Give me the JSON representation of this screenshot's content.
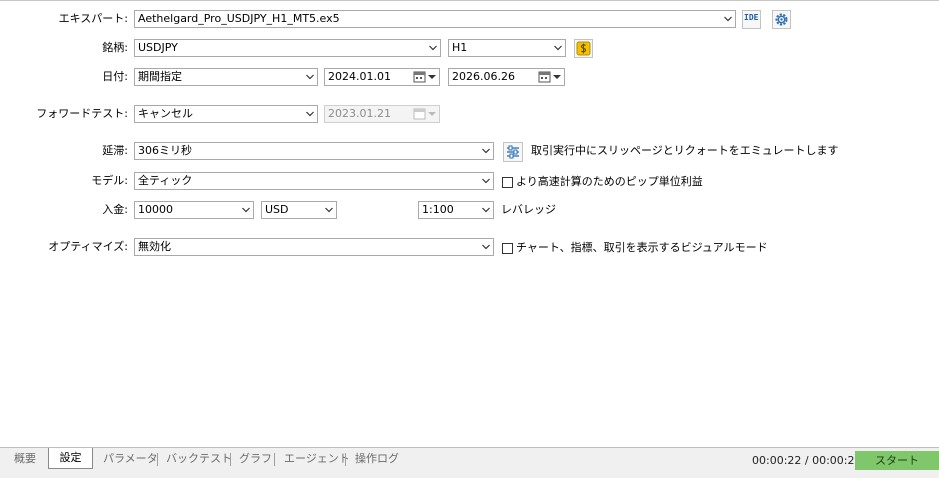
{
  "form": {
    "expert_label": "エキスパート:",
    "expert_value": "Aethelgard_Pro_USDJPY_H1_MT5.ex5",
    "ide_label": "IDE",
    "symbol_label": "銘柄:",
    "symbol_value": "USDJPY",
    "timeframe_value": "H1",
    "date_label": "日付:",
    "date_mode_value": "期間指定",
    "date_from": "2024.01.01",
    "date_to": "2026.06.26",
    "forward_label": "フォワードテスト:",
    "forward_value": "キャンセル",
    "forward_date": "2023.01.21",
    "delay_label": "延滞:",
    "delay_value": "306ミリ秒",
    "delay_desc": "取引実行中にスリッページとリクォートをエミュレートします",
    "model_label": "モデル:",
    "model_value": "全ティック",
    "model_check_label": "より高速計算のためのピップ単位利益",
    "deposit_label": "入金:",
    "deposit_value": "10000",
    "currency_value": "USD",
    "leverage_value": "1:100",
    "leverage_label": "レバレッジ",
    "optimize_label": "オプティマイズ:",
    "optimize_value": "無効化",
    "visual_check_label": "チャート、指標、取引を表示するビジュアルモード"
  },
  "tabs": [
    {
      "label": "概要"
    },
    {
      "label": "設定"
    },
    {
      "label": "パラメータ"
    },
    {
      "label": "バックテスト"
    },
    {
      "label": "グラフ"
    },
    {
      "label": "エージェント"
    },
    {
      "label": "操作ログ"
    }
  ],
  "footer": {
    "timer": "00:00:22 / 00:00:22",
    "start_label": "スタート"
  },
  "colors": {
    "start_button": "#7fc76a",
    "coin_icon": "#f2c200"
  }
}
